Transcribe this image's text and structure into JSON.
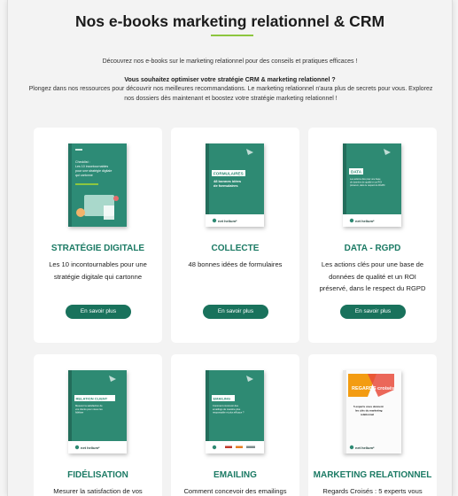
{
  "header": {
    "title": "Nos e-books marketing relationnel & CRM",
    "intro": "Découvrez nos e-books sur le marketing relationnel pour des conseils et pratiques efficaces !",
    "question": "Vous souhaitez optimiser votre stratégie CRM & marketing relationnel ?",
    "paragraph": "Plongez dans nos ressources pour découvrir nos meilleures recommandations. Le marketing relationnel n'aura plus de secrets pour vous. Explorez nos dossiers dès maintenant et boostez votre stratégie marketing relationnel !"
  },
  "cards": [
    {
      "name": "STRATÉGIE DIGITALE",
      "desc": "Les 10 incontournables pour une stratégie digitale qui cartonne",
      "button": "En savoir plus",
      "cover_lines": [
        "Checklist :",
        "Les 10 incontournables",
        "pour une stratégie digitale",
        "qui cartonne"
      ]
    },
    {
      "name": "COLLECTE",
      "desc": "48 bonnes idées de formulaires",
      "button": "En savoir plus",
      "cover_tag": "FORMULAIRES",
      "cover_lines": [
        "48 bonnes idées",
        "de formulaires"
      ]
    },
    {
      "name": "DATA - RGPD",
      "desc": "Les actions clés pour une base de données de qualité et un ROI préservé, dans le respect du RGPD",
      "button": "En savoir plus",
      "cover_tag": "DATA",
      "cover_lines": [
        "Les actions clés pour une base",
        "de données de qualité et un ROI",
        "préservé, dans le respect du RGPD"
      ]
    },
    {
      "name": "FIDÉLISATION",
      "desc": "Mesurer la satisfaction de vos",
      "cover_tag": "RELATION CLIENT",
      "cover_lines": [
        "Mesurer la satisfaction de",
        "vos clients pour mieux les",
        "fidéliser"
      ]
    },
    {
      "name": "EMAILING",
      "desc": "Comment concevoir des emailings",
      "cover_tag": "EMAILING",
      "cover_lines": [
        "Comment concevoir des",
        "emailings de manière plus",
        "responsable et plus efficace ?"
      ]
    },
    {
      "name": "MARKETING RELATIONNEL",
      "desc": "Regards Croisés : 5 experts vous",
      "cover_tag": "REGARDS croisés",
      "cover_lines": [
        "5 experts vous donnent",
        "les clés du marketing",
        "relationnel"
      ]
    }
  ],
  "brand": {
    "logo_text": "net heliumᵉ",
    "colors": {
      "green": "#1b7a64",
      "button": "#19725c",
      "accent": "#8dc63f",
      "cover_teal": "#2e8a73"
    }
  }
}
